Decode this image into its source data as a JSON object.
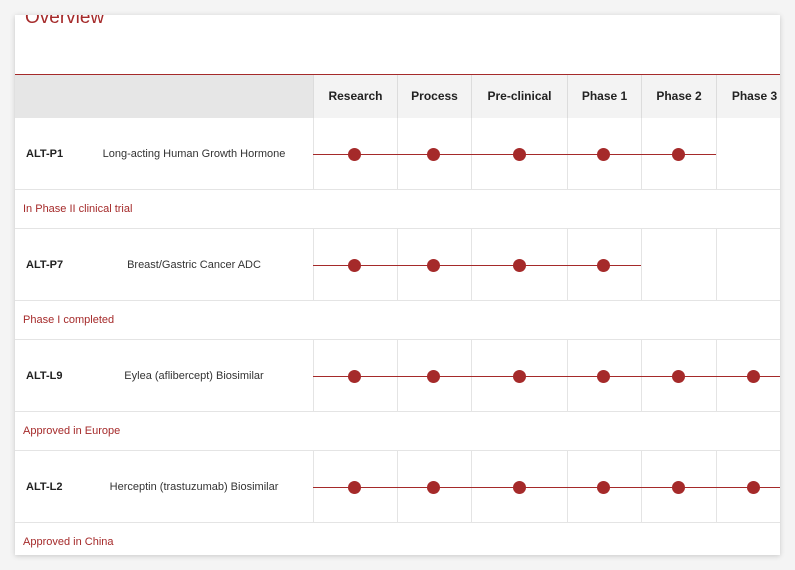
{
  "section": {
    "title": "Overview"
  },
  "phases": [
    "Research",
    "Process",
    "Pre-clinical",
    "Phase 1",
    "Phase 2",
    "Phase 3"
  ],
  "accent_color": "#a52a2a",
  "pipeline": [
    {
      "code": "ALT-P1",
      "name": "Long-acting Human Growth Hormone",
      "stages_completed": 5,
      "status": "In Phase II clinical trial"
    },
    {
      "code": "ALT-P7",
      "name": "Breast/Gastric Cancer ADC",
      "stages_completed": 4,
      "status": "Phase I completed"
    },
    {
      "code": "ALT-L9",
      "name": "Eylea (aflibercept) Biosimilar",
      "stages_completed": 6,
      "status": "Approved in Europe"
    },
    {
      "code": "ALT-L2",
      "name": "Herceptin (trastuzumab) Biosimilar",
      "stages_completed": 6,
      "status": "Approved in China"
    }
  ]
}
